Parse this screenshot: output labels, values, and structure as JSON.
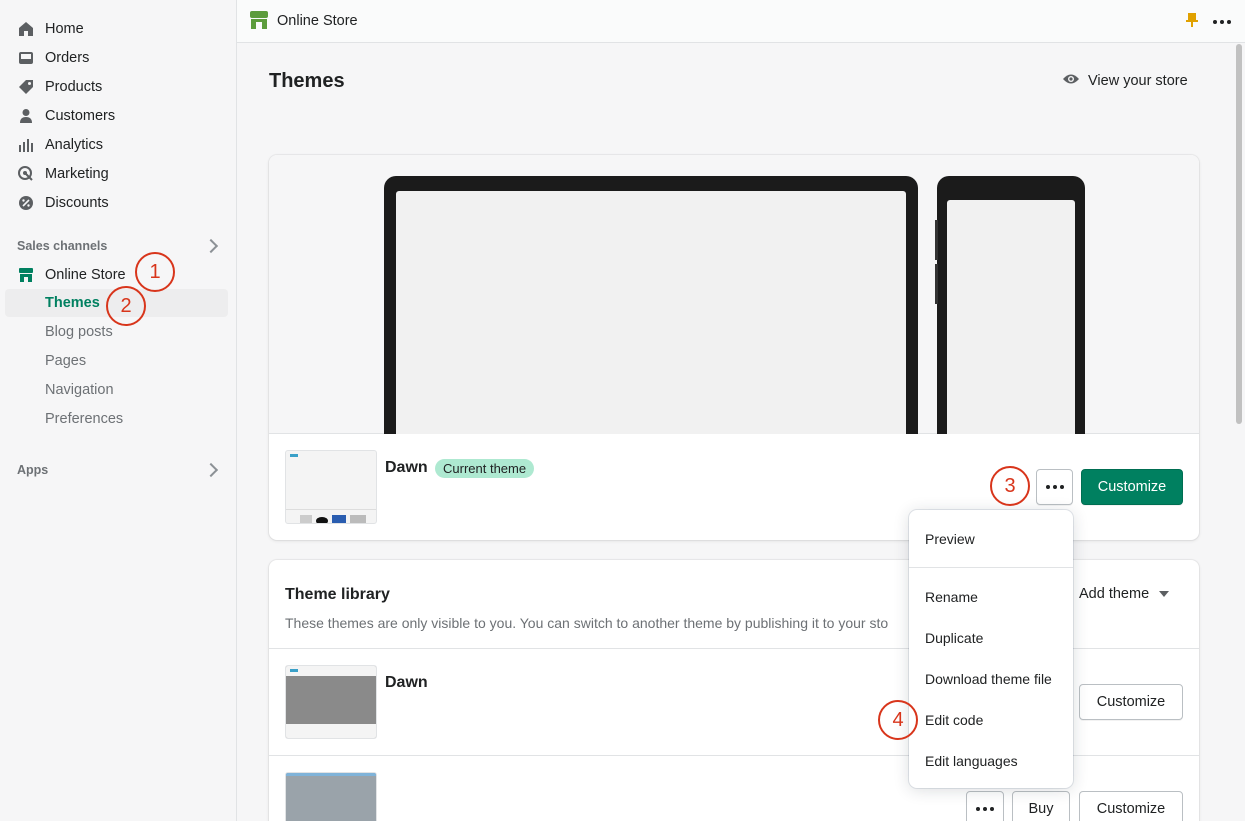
{
  "sidebar": {
    "main_items": [
      {
        "label": "Home",
        "icon": "home-icon"
      },
      {
        "label": "Orders",
        "icon": "orders-icon"
      },
      {
        "label": "Products",
        "icon": "tag-icon"
      },
      {
        "label": "Customers",
        "icon": "person-icon"
      },
      {
        "label": "Analytics",
        "icon": "bar-chart-icon"
      },
      {
        "label": "Marketing",
        "icon": "target-icon"
      },
      {
        "label": "Discounts",
        "icon": "discount-icon"
      }
    ],
    "sales_channels_label": "Sales channels",
    "online_store_label": "Online Store",
    "sub_items": [
      {
        "label": "Themes"
      },
      {
        "label": "Blog posts"
      },
      {
        "label": "Pages"
      },
      {
        "label": "Navigation"
      },
      {
        "label": "Preferences"
      }
    ],
    "apps_label": "Apps"
  },
  "annotations": [
    "1",
    "2",
    "3",
    "4"
  ],
  "topbar": {
    "title": "Online Store"
  },
  "page": {
    "title": "Themes",
    "view_store": "View your store"
  },
  "current_theme": {
    "name": "Dawn",
    "badge": "Current theme",
    "customize_label": "Customize"
  },
  "library": {
    "title": "Theme library",
    "description": "These themes are only visible to you. You can switch to another theme by publishing it to your sto",
    "add_theme": "Add theme",
    "rows": [
      {
        "name": "Dawn",
        "customize": "Customize"
      },
      {
        "name": "",
        "buy": "Buy",
        "customize": "Customize"
      }
    ]
  },
  "menu": {
    "items": [
      "Preview",
      "Rename",
      "Duplicate",
      "Download theme file",
      "Edit code",
      "Edit languages"
    ]
  },
  "colors": {
    "accent": "#008060",
    "annotation": "#d8351b",
    "badge": "#aee9d1"
  }
}
